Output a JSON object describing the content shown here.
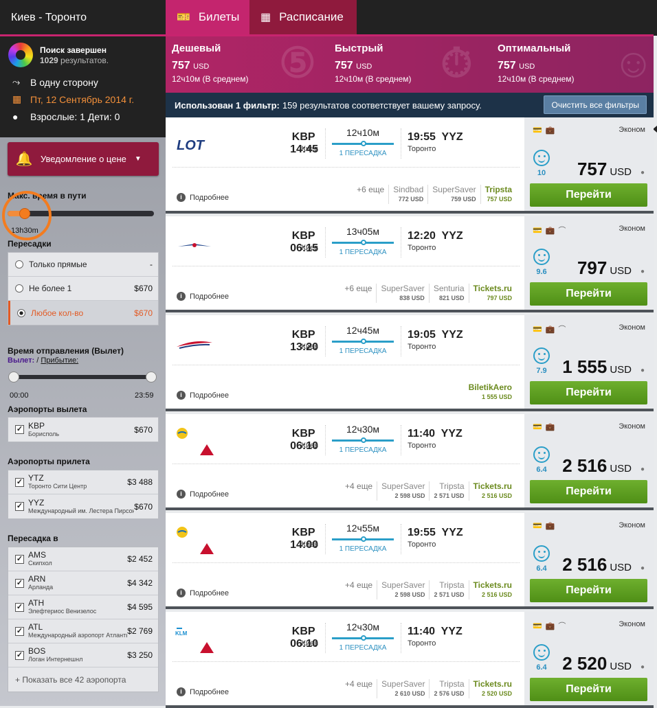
{
  "route": "Киев - Торонто",
  "search": {
    "status": "Поиск завершен",
    "count": "1029",
    "count_suffix": " результатов."
  },
  "trip": {
    "type": "В одну сторону",
    "date": "Пт, 12 Сентябрь 2014 г.",
    "pax": "Взрослые: 1 Дети: 0"
  },
  "notify_label": "Уведомление о цене",
  "filters": {
    "max_time": {
      "label": "Макс. время в пути",
      "value": "13h30m"
    },
    "stops": {
      "label": "Пересадки",
      "options": [
        {
          "label": "Только прямые",
          "price": "-"
        },
        {
          "label": "Не более 1",
          "price": "$670"
        },
        {
          "label": "Любое кол-во",
          "price": "$670"
        }
      ]
    },
    "dep_time": {
      "label": "Время отправления (Вылет)",
      "depart": "Вылет:",
      "sep": " / ",
      "arrive": "Прибытие:",
      "from": "00:00",
      "to": "23:59"
    },
    "dep_airports": {
      "label": "Аэропорты вылета",
      "items": [
        {
          "code": "KBP",
          "name": "Борисполь",
          "price": "$670"
        }
      ]
    },
    "arr_airports": {
      "label": "Аэропорты прилета",
      "items": [
        {
          "code": "YTZ",
          "name": "Торонто Сити Центр",
          "price": "$3 488"
        },
        {
          "code": "YYZ",
          "name": "Международный им. Лестера Пирсона",
          "price": "$670"
        }
      ]
    },
    "transfer": {
      "label": "Пересадка в",
      "items": [
        {
          "code": "AMS",
          "name": "Скипхол",
          "price": "$2 452"
        },
        {
          "code": "ARN",
          "name": "Арланда",
          "price": "$4 342"
        },
        {
          "code": "ATH",
          "name": "Элефтериос Венизелос",
          "price": "$4 595"
        },
        {
          "code": "ATL",
          "name": "Международный аэропорт Атланты",
          "price": "$2 769"
        },
        {
          "code": "BOS",
          "name": "Логан Интернешнл",
          "price": "$3 250"
        }
      ],
      "show_all": "+ Показать все 42 аэропорта"
    }
  },
  "tabs": {
    "tickets": "Билеты",
    "schedule": "Расписание"
  },
  "summary": [
    {
      "title": "Дешевый",
      "price": "757",
      "cur": "USD",
      "dur": "12ч10м (В среднем)"
    },
    {
      "title": "Быстрый",
      "price": "757",
      "cur": "USD",
      "dur": "12ч10м (В среднем)"
    },
    {
      "title": "Оптимальный",
      "price": "757",
      "cur": "USD",
      "dur": "12ч10м (В среднем)"
    }
  ],
  "filter_info": {
    "bold": "Использован 1 фильтр:",
    "text": "159 результатов соответствует вашему запросу.",
    "clear": "Очистить все фильтры"
  },
  "common": {
    "more": "Подробнее",
    "go": "Перейти",
    "stops": "1 ПЕРЕСАДКА",
    "class": "Эконом",
    "dep_city": "Киев",
    "arr_city": "Торонто",
    "from": "KBP",
    "to": "YYZ",
    "cur": "USD"
  },
  "flights": [
    {
      "airline": "LOT",
      "dep": "14:45",
      "arr": "19:55",
      "dur": "12ч10м",
      "price": "757",
      "rating": "10",
      "plus": "+6 еще",
      "agents": [
        {
          "n": "Sindbad",
          "v": "772 USD"
        },
        {
          "n": "SuperSaver",
          "v": "759 USD"
        },
        {
          "n": "Tripsta",
          "v": "757 USD"
        }
      ]
    },
    {
      "airline": "Aeroflot",
      "dep": "06:15",
      "arr": "12:20",
      "dur": "13ч05м",
      "price": "797",
      "rating": "9.6",
      "plus": "+6 еще",
      "agents": [
        {
          "n": "SuperSaver",
          "v": "838 USD"
        },
        {
          "n": "Senturia",
          "v": "821 USD"
        },
        {
          "n": "Tickets.ru",
          "v": "797 USD"
        }
      ]
    },
    {
      "airline": "British Airways",
      "dep": "13:20",
      "arr": "19:05",
      "dur": "12ч45м",
      "price": "1 555",
      "rating": "7.9",
      "plus": "",
      "agents": [
        {
          "n": "BiletikAero",
          "v": "1 555 USD"
        }
      ]
    },
    {
      "airline": "UIA + Delta",
      "dep": "06:10",
      "arr": "11:40",
      "dur": "12ч30м",
      "price": "2 516",
      "rating": "6.4",
      "plus": "+4 еще",
      "agents": [
        {
          "n": "SuperSaver",
          "v": "2 598 USD"
        },
        {
          "n": "Tripsta",
          "v": "2 571 USD"
        },
        {
          "n": "Tickets.ru",
          "v": "2 516 USD"
        }
      ]
    },
    {
      "airline": "UIA + Delta",
      "dep": "14:00",
      "arr": "19:55",
      "dur": "12ч55м",
      "price": "2 516",
      "rating": "6.4",
      "plus": "+4 еще",
      "agents": [
        {
          "n": "SuperSaver",
          "v": "2 598 USD"
        },
        {
          "n": "Tripsta",
          "v": "2 571 USD"
        },
        {
          "n": "Tickets.ru",
          "v": "2 516 USD"
        }
      ]
    },
    {
      "airline": "KLM + Delta",
      "dep": "06:10",
      "arr": "11:40",
      "dur": "12ч30м",
      "price": "2 520",
      "rating": "6.4",
      "plus": "+4 еще",
      "agents": [
        {
          "n": "SuperSaver",
          "v": "2 610 USD"
        },
        {
          "n": "Tripsta",
          "v": "2 576 USD"
        },
        {
          "n": "Tickets.ru",
          "v": "2 520 USD"
        }
      ]
    }
  ]
}
